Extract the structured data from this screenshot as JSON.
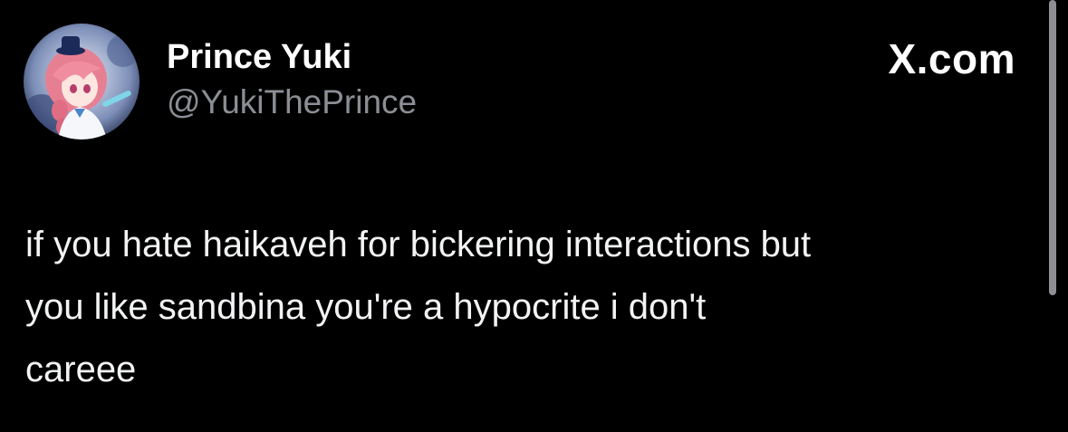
{
  "author": {
    "display_name": "Prince Yuki",
    "handle": "@YukiThePrince",
    "avatar_icon": "anime-character-avatar"
  },
  "site": {
    "logo_text": "X.com"
  },
  "tweet": {
    "lines": [
      "if you hate haikaveh for bickering interactions but",
      "you like sandbina you're a hypocrite i don't",
      "careee"
    ]
  },
  "colors": {
    "background": "#000000",
    "text": "#e7e9ea",
    "handle": "#8b8f94",
    "scrollbar": "#8e8e93"
  }
}
